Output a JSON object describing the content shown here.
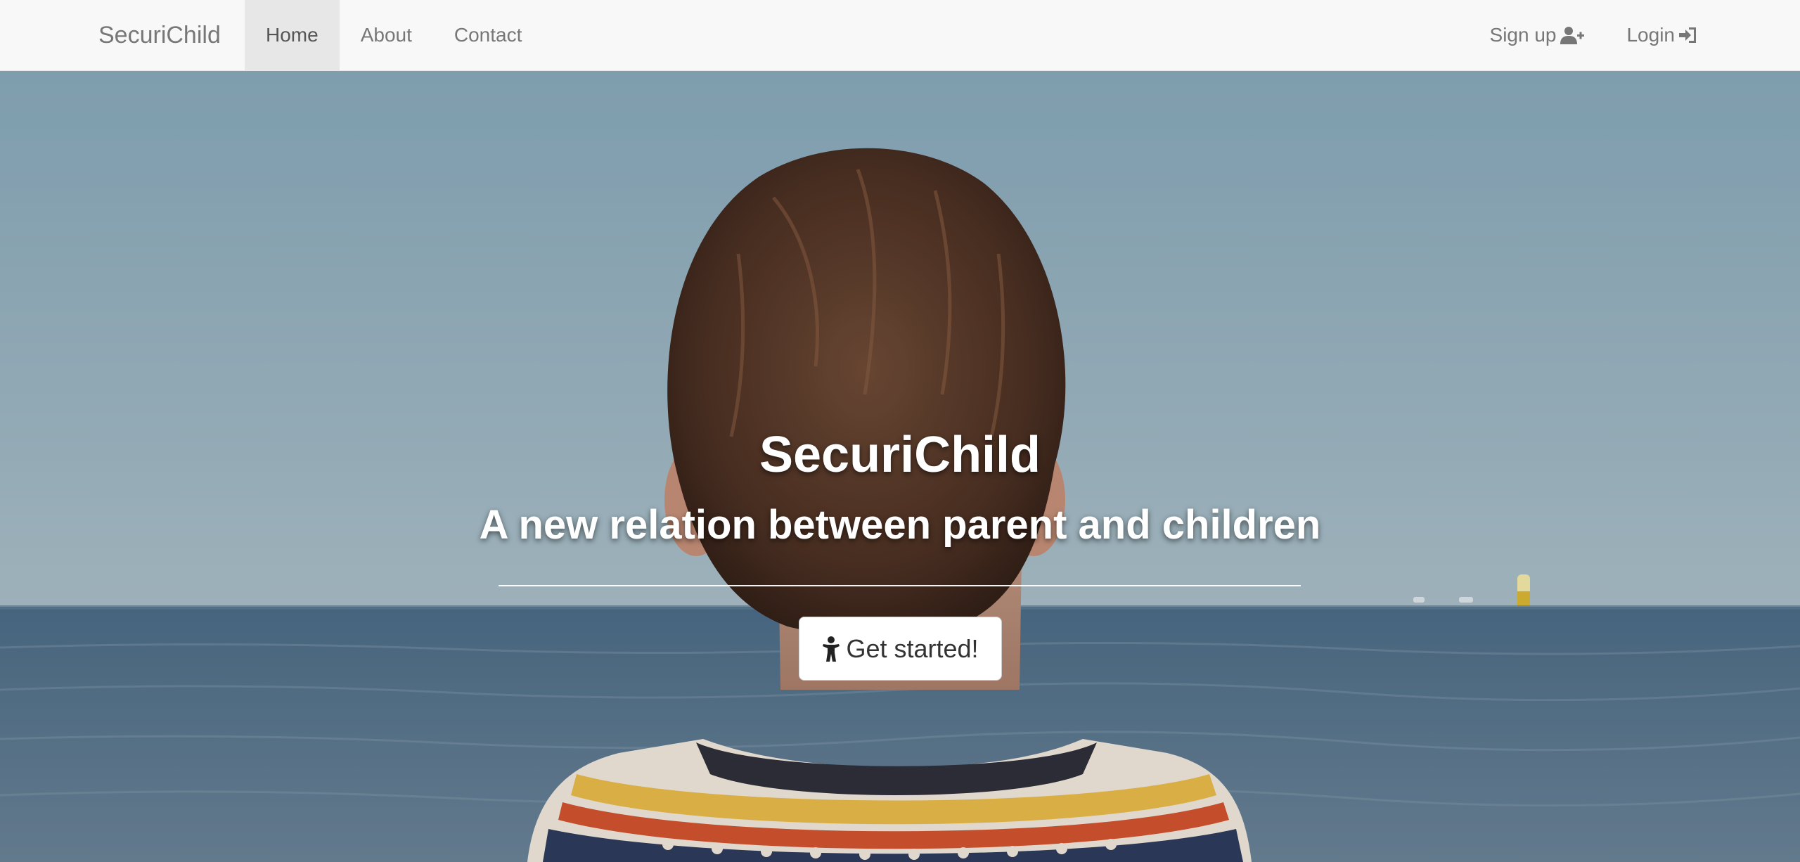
{
  "navbar": {
    "brand": "SecuriChild",
    "items": [
      {
        "label": "Home",
        "active": true
      },
      {
        "label": "About",
        "active": false
      },
      {
        "label": "Contact",
        "active": false
      }
    ],
    "right_items": [
      {
        "label": "Sign up",
        "icon": "user-plus-icon"
      },
      {
        "label": "Login",
        "icon": "sign-in-icon"
      }
    ]
  },
  "hero": {
    "title": "SecuriChild",
    "subtitle": "A new relation between parent and children",
    "cta_label": "Get started!",
    "cta_icon": "child-icon"
  },
  "colors": {
    "navbar_bg": "#f8f8f8",
    "nav_active_bg": "#e7e7e7",
    "nav_text": "#777777",
    "sky": "#8fb0c0",
    "sea": "#4f6f88"
  }
}
